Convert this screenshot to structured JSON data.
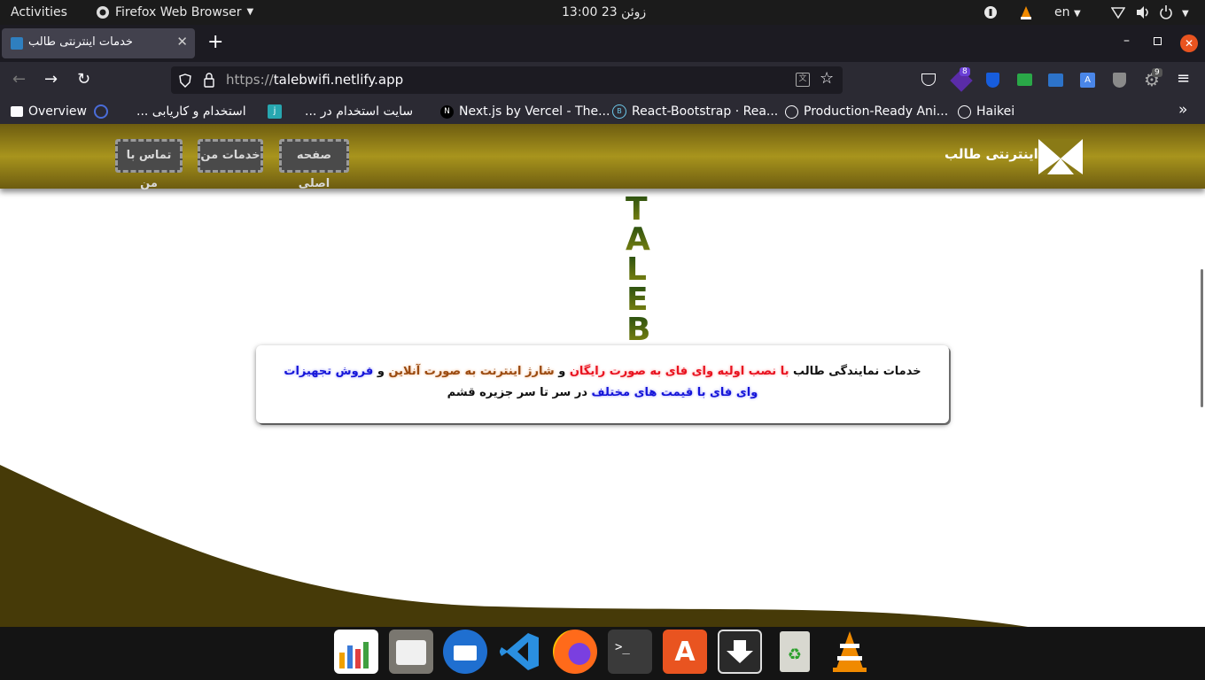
{
  "topbar": {
    "activities": "Activities",
    "app_name": "Firefox Web Browser",
    "clock": "زوئن 23  13:00",
    "lang": "en"
  },
  "tab": {
    "title": "خدمات اینترنتی طالب"
  },
  "urlbar": {
    "url_prefix": "https://",
    "url_host": "talebwifi.netlify.app"
  },
  "toolbar": {
    "ext_badge_1": "8",
    "ext_badge_2": "9"
  },
  "bookmarks": [
    {
      "label": "Overview"
    },
    {
      "label": "استخدام و کاریابی ..."
    },
    {
      "label": "سایت استخدام در ..."
    },
    {
      "label": "Next.js by Vercel - The..."
    },
    {
      "label": "React-Bootstrap · Rea..."
    },
    {
      "label": "Production-Ready Ani..."
    },
    {
      "label": "Haikei"
    }
  ],
  "site": {
    "brand": "اینترنتی طالب",
    "nav": [
      "صفحه اصلی",
      "خدمات من",
      "تماس با من"
    ],
    "vertical_letters": [
      "T",
      "A",
      "L",
      "E",
      "B"
    ],
    "card": {
      "t1": "خدمات نمایندگی طالب",
      "t2": "با نصب اولیه وای فای به صورت رایگان",
      "t3": "و",
      "t4": "شارژ اینترنت به صورت آنلاین",
      "t5": "و",
      "t6": "فروش تجهیزات وای فای با قیمت های مختلف",
      "t7": "در سر تا سر جزیره قشم"
    },
    "colors": {
      "header": "#a8941d",
      "wave": "#463a08",
      "red": "#e8121f",
      "brown": "#9a4a10",
      "blue": "#1414d8"
    }
  },
  "dock": [
    "spreadsheet-icon",
    "files-icon",
    "thunderbird-icon",
    "vscode-icon",
    "firefox-icon",
    "terminal-icon",
    "software-center-icon",
    "downloader-icon",
    "trash-icon",
    "vlc-icon"
  ]
}
